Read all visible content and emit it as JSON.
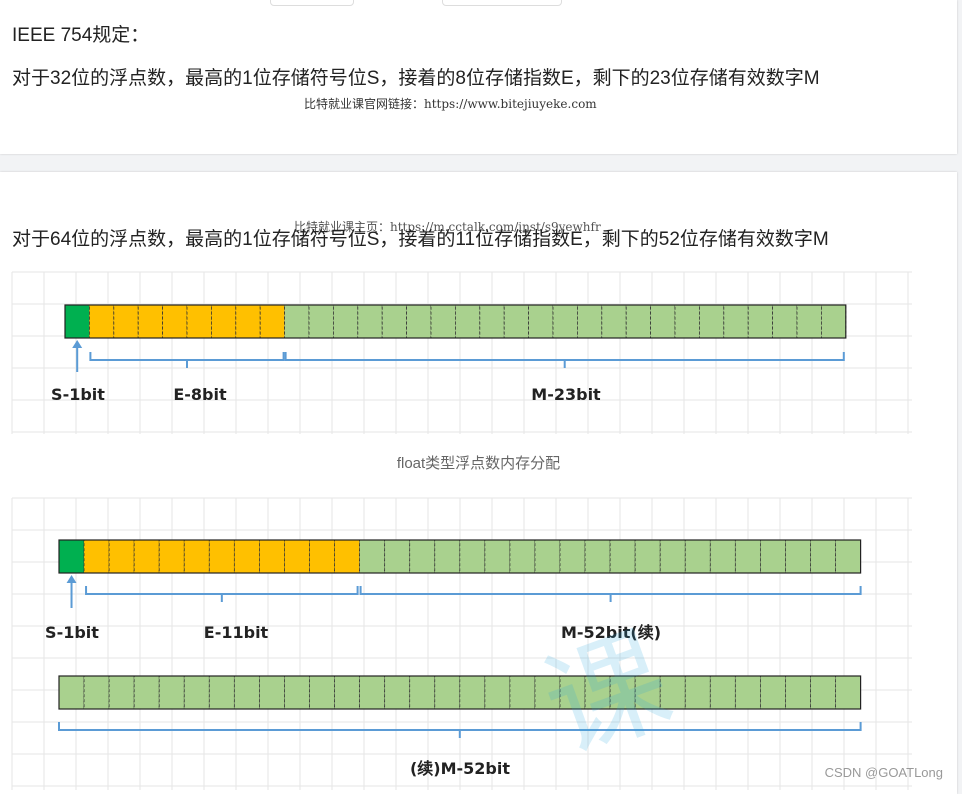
{
  "top": {
    "standard_title": "IEEE 754规定：",
    "float32_desc": "对于32位的浮点数，最高的1位存储符号位S，接着的8位存储指数E，剩下的23位存储有效数字M",
    "watermark_link": "比特就业课官网链接：https://www.bitejiuyeke.com"
  },
  "bottom": {
    "watermark_overlay": "比特就业课主页：https://m.cctalk.com/inst/s9yewhfr",
    "float64_desc": "对于64位的浮点数，最高的1位存储符号位S，接着的11位存储指数E，剩下的52位存储有效数字M",
    "float_caption": "float类型浮点数内存分配",
    "watermark_char": "课"
  },
  "diagrams": {
    "float": {
      "labels": {
        "sign": "S-1bit",
        "exponent": "E-8bit",
        "mantissa": "M-23bit"
      }
    },
    "double": {
      "labels": {
        "sign": "S-1bit",
        "exponent": "E-11bit",
        "mantissa": "M-52bit(续)",
        "continuation": "(续)M-52bit"
      }
    }
  },
  "colors": {
    "sign": "#00b050",
    "exponent": "#ffc000",
    "mantissa": "#a9d18e",
    "bracket": "#5b9bd5",
    "grid": "#e6e6e6"
  },
  "footer": "CSDN @GOATLong"
}
